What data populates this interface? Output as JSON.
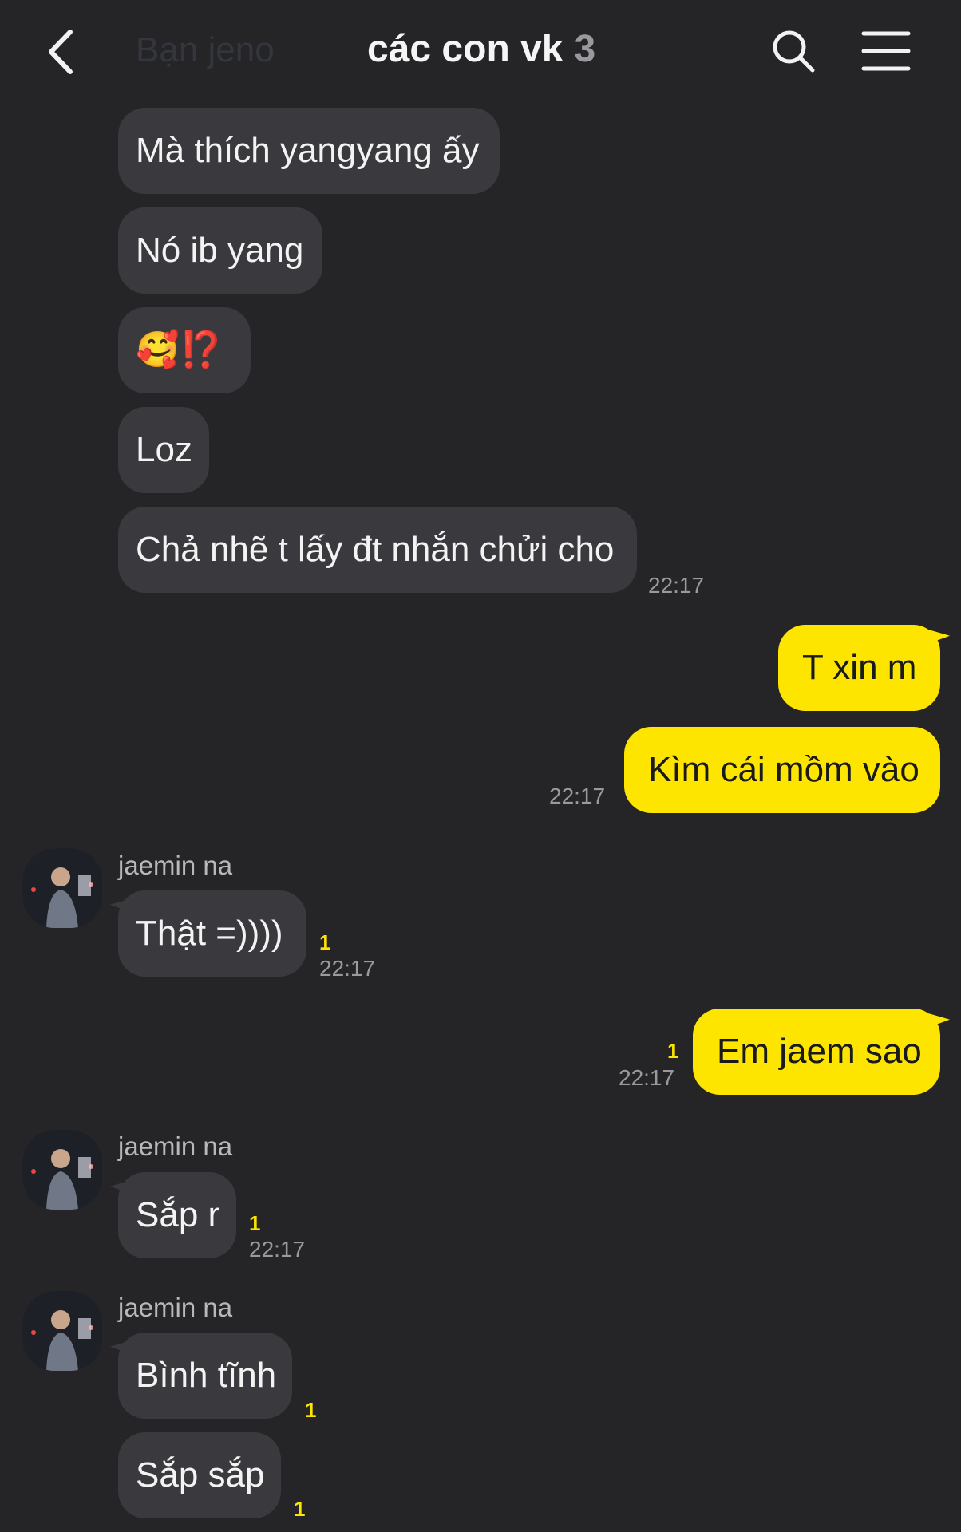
{
  "header": {
    "prev_title": "Bạn jeno",
    "title": "các con vk",
    "member_count": "3"
  },
  "messages": [
    {
      "text": "Mà thích yangyang ấy"
    },
    {
      "text": "Nó ib yang"
    },
    {
      "text": "🥰⁉️"
    },
    {
      "text": "Loz"
    },
    {
      "text": "Chả nhẽ t lấy đt nhắn chửi cho",
      "time": "22:17"
    },
    {
      "text": "T xin m"
    },
    {
      "text": "Kìm cái mồm vào",
      "time": "22:17"
    },
    {
      "sender": "jaemin na",
      "text": "Thật =))))",
      "unread": "1",
      "time": "22:17"
    },
    {
      "text": "Em jaem sao",
      "unread": "1",
      "time": "22:17"
    },
    {
      "sender": "jaemin na",
      "text": "Sắp r",
      "unread": "1",
      "time": "22:17"
    },
    {
      "sender": "jaemin na",
      "text": "Bình tĩnh",
      "unread": "1"
    },
    {
      "text": "Sắp sắp",
      "unread": "1"
    }
  ],
  "colors": {
    "background": "#252528",
    "incoming_bubble": "#3a3a3e",
    "outgoing_bubble": "#fee500",
    "unread_count": "#fee500"
  },
  "icons": [
    "back-arrow-icon",
    "search-icon",
    "menu-icon"
  ]
}
